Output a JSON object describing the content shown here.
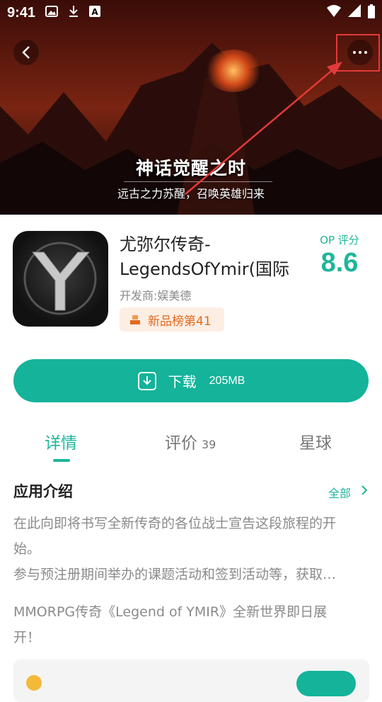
{
  "status_bar": {
    "time": "9:41"
  },
  "banner": {
    "title": "神话觉醒之时",
    "subtitle": "远古之力苏醒，召唤英雄归来"
  },
  "app": {
    "name": "尤弥尔传奇-LegendsOfYmir(国际",
    "developer": "开发商:娱美德",
    "rank_badge": "新品榜第41",
    "op_label": "OP 评分",
    "op_score": "8.6"
  },
  "download": {
    "label": "下载",
    "size": "205MB"
  },
  "tabs": [
    {
      "label": "详情",
      "count": ""
    },
    {
      "label": "评价",
      "count": "39"
    },
    {
      "label": "星球",
      "count": ""
    }
  ],
  "intro": {
    "title": "应用介绍",
    "see_all": "全部",
    "paragraph1_line1": "在此向即将书写全新传奇的各位战士宣告这段旅程的开",
    "paragraph1_line2": "始。",
    "paragraph2": "参与预注册期间举办的课题活动和签到活动等，获取…",
    "paragraph3_line1": "MMORPG传奇《Legend of YMIR》全新世界即日展",
    "paragraph3_line2": "开！"
  },
  "colors": {
    "accent": "#14b39a",
    "annotation": "#e23a3a",
    "badge_text": "#e06a20"
  }
}
